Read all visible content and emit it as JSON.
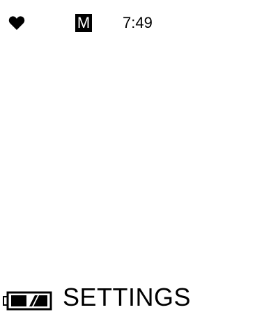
{
  "status_bar": {
    "heart_icon": "heart-icon",
    "mode_badge": "M",
    "time": "7:49"
  },
  "footer": {
    "battery_icon": "battery-icon",
    "battery_level": 0.66,
    "title": "SETTINGS"
  },
  "colors": {
    "background": "#ffffff",
    "foreground": "#000000"
  }
}
